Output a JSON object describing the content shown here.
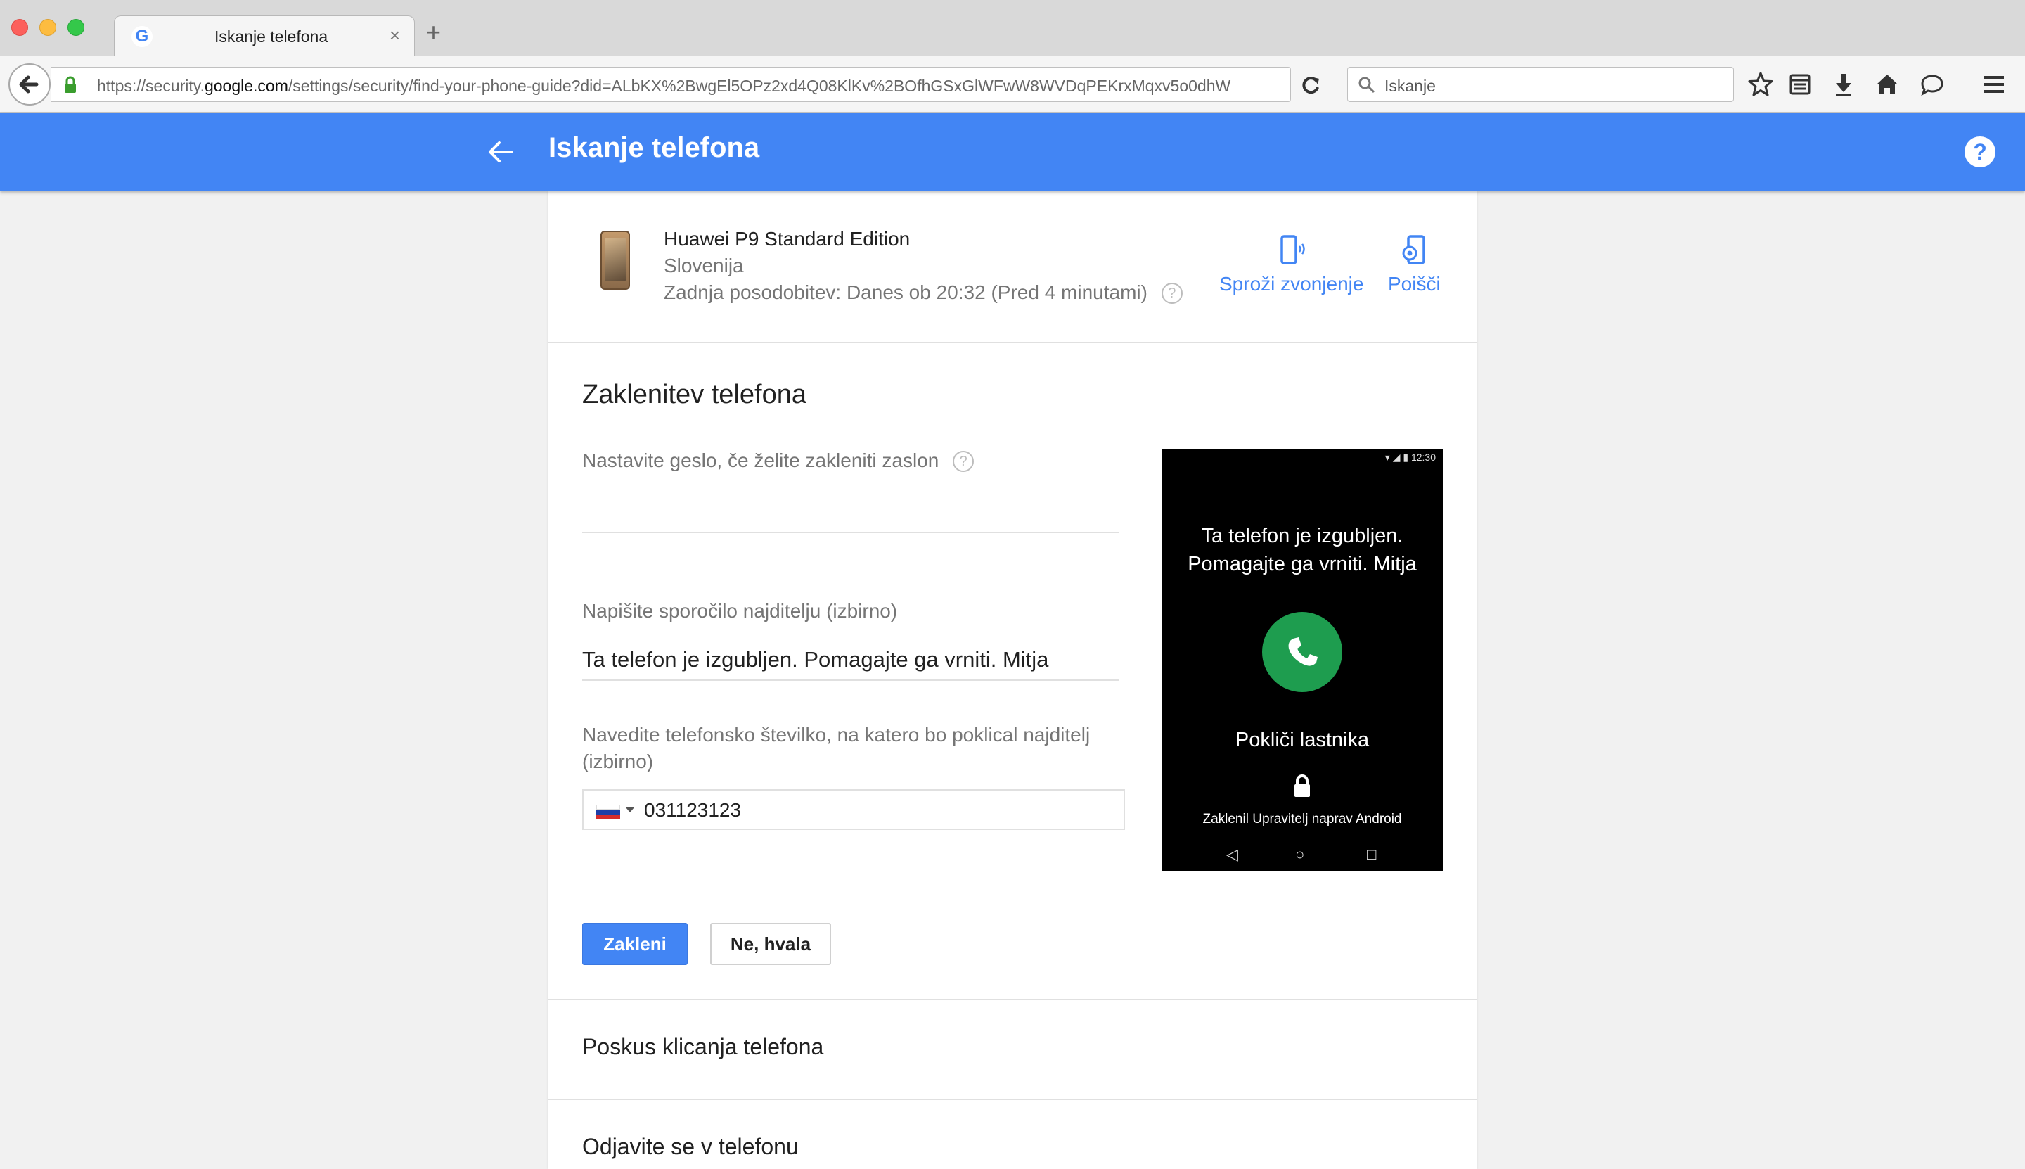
{
  "browser": {
    "tab_title": "Iskanje telefona",
    "url_prefix": "https://security.",
    "url_domain": "google.com",
    "url_path": "/settings/security/find-your-phone-guide?did=ALbKX%2BwgEl5OPz2xd4Q08KlKv%2BOfhGSxGlWFwW8WVDqPEKrxMqxv5o0dhW",
    "search_placeholder": "Iskanje"
  },
  "header": {
    "title": "Iskanje telefona",
    "help": "?"
  },
  "device": {
    "name": "Huawei P9 Standard Edition",
    "country": "Slovenija",
    "last_update": "Zadnja posodobitev: Danes ob 20:32 (Pred 4 minutami)",
    "actions": {
      "ring": "Sproži zvonjenje",
      "locate": "Poišči"
    }
  },
  "lock": {
    "title": "Zaklenitev telefona",
    "password_label": "Nastavite geslo, če želite zakleniti zaslon",
    "message_label": "Napišite sporočilo najditelju (izbirno)",
    "message_value": "Ta telefon je izgubljen. Pomagajte ga vrniti. Mitja",
    "phone_label_line1": "Navedite telefonsko številko, na katero bo poklical najditelj",
    "phone_label_line2": "(izbirno)",
    "phone_value": "031123123",
    "lock_button": "Zakleni",
    "cancel_button": "Ne, hvala"
  },
  "preview": {
    "status_time": "12:30",
    "message_line1": "Ta telefon je izgubljen.",
    "message_line2": "Pomagajte ga vrniti. Mitja",
    "call_label": "Pokliči lastnika",
    "locked_by": "Zaklenil Upravitelj naprav Android"
  },
  "sections": {
    "call": "Poskus klicanja telefona",
    "signout": "Odjavite se v telefonu"
  },
  "colors": {
    "accent": "#4285f4",
    "call_green": "#1e9d4f"
  }
}
